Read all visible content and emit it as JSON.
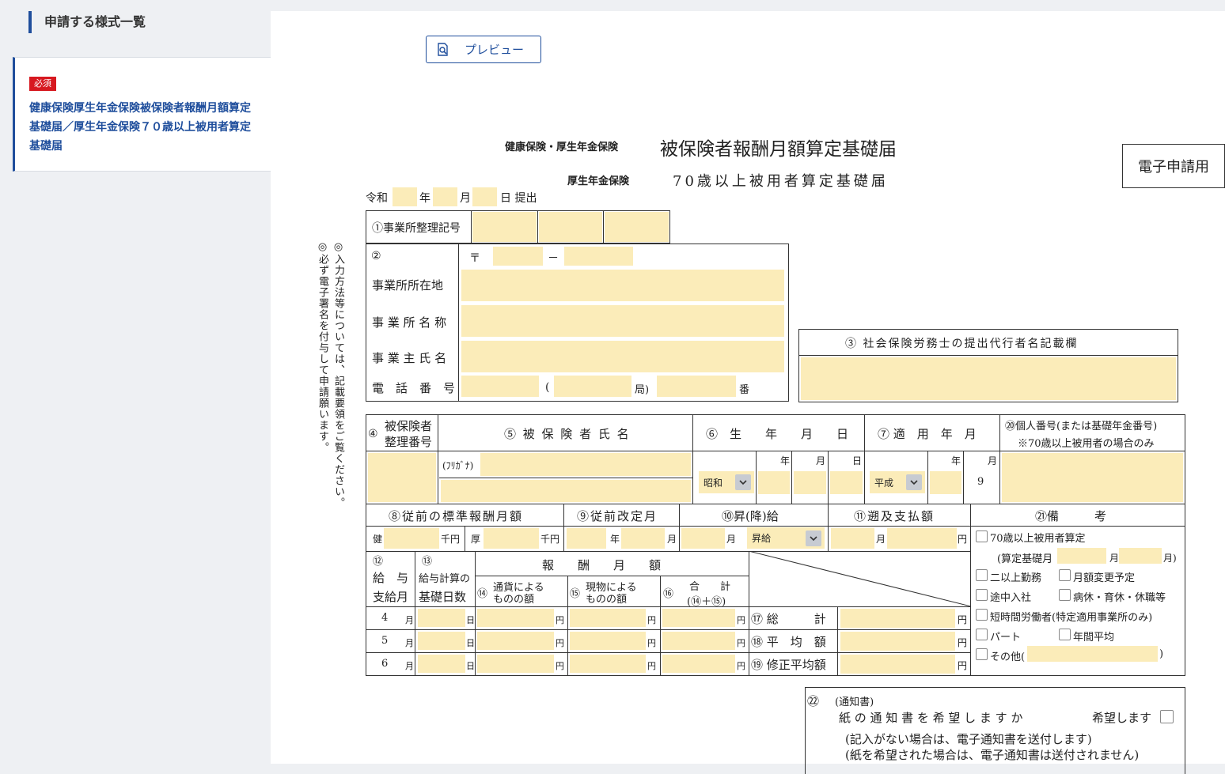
{
  "sidebar": {
    "title": "申請する様式一覧",
    "item": {
      "badge": "必須",
      "label": "健康保険厚生年金保険被保険者報酬月額算定基礎届／厚生年金保険７０歳以上被用者算定基礎届"
    }
  },
  "toolbar": {
    "preview_label": "プレビュー"
  },
  "form": {
    "header_small": "健康保険・厚生年金保険",
    "header_title": "被保険者報酬月額算定基礎届",
    "header_sub_small": "厚生年金保険",
    "header_sub_title": "70歳以上被用者算定基礎届",
    "e_filing": "電子申請用",
    "reiwa": "令和",
    "year": "年",
    "month": "月",
    "day_submit": "日 提出",
    "vertical_note1": "◎入力方法等については、記載要領をご覧ください。",
    "vertical_note2": "◎必ず電子署名を付与して申請願います。",
    "office_code": "①事業所整理記号",
    "circle2": "②",
    "postal": "〒",
    "dash": "－",
    "office_address": "事業所所在地",
    "office_name": "事 業 所 名 称",
    "owner_name": "事 業 主 氏 名",
    "phone": "電　話　番　号",
    "phone_paren_open": "(",
    "phone_kyoku": "局)",
    "phone_ban": "番",
    "agent_title": "③ 社会保険労務士の提出代行者名記載欄",
    "col4": "④",
    "col4_label1": "被保険者",
    "col4_label2": "整理番号",
    "col5": "⑤ 被 保 険 者 氏 名",
    "col6": "⑥　生　　年　　月　　日",
    "col7": "⑦ 適　用　年　月",
    "col20_1": "⑳個人番号(または基礎年金番号)",
    "col20_2": "※70歳以上被用者の場合のみ",
    "furigana": "(ﾌﾘｶﾞﾅ)",
    "era_birth": "昭和",
    "era_apply": "平成",
    "apply_month": "9",
    "ymd_y": "年",
    "ymd_m": "月",
    "ymd_d": "日",
    "col8": "⑧従前の標準報酬月額",
    "col9": "⑨従前改定月",
    "col10": "⑩昇(降)給",
    "col11": "⑪遡及支払額",
    "col21": "㉑備　　　考",
    "ken": "健",
    "kou": "厚",
    "senyen": "千円",
    "raise_type": "昇給",
    "yen": "円",
    "col12_a": "⑫",
    "col12_b": "給　与",
    "col12_c": "支給月",
    "col13_a": "⑬",
    "col13_b": "給与計算の",
    "col13_c": "基礎日数",
    "remuneration": "報　　酬　　月　　額",
    "col14_a": "⑭",
    "col14_b": "通貨による",
    "col14_c": "ものの額",
    "col15_a": "⑮",
    "col15_b": "現物による",
    "col15_c": "ものの額",
    "col16_a": "⑯",
    "col16_b": "合　　計",
    "col16_c": "(⑭＋⑮)",
    "months": [
      "4",
      "5",
      "6"
    ],
    "nichi": "日",
    "col17": "⑰ 総　　　計",
    "col18": "⑱ 平　均　額",
    "col19": "⑲ 修正平均額",
    "remarks": {
      "age70": "70歳以上被用者算定",
      "calc_month_open": "(算定基礎月",
      "calc_month_mid": "月",
      "calc_month_close": "月)",
      "multi_work": "二以上勤務",
      "monthly_change": "月額変更予定",
      "mid_join": "途中入社",
      "leave": "病休・育休・休職等",
      "short_time": "短時間労働者(特定適用事業所のみ)",
      "part": "パート",
      "annual_avg": "年間平均",
      "other": "その他(",
      "other_close": ")"
    },
    "notice_num": "㉒",
    "notice_title": "(通知書)",
    "notice_q": "紙 の 通 知 書 を 希 望 し ま す か",
    "notice_want": "希望します",
    "notice_note1": "(記入がない場合は、電子通知書を送付します)",
    "notice_note2": "(紙を希望された場合は、電子通知書は送付されません)"
  }
}
